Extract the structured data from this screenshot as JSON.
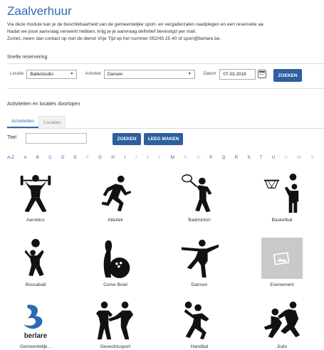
{
  "page": {
    "title": "Zaalverhuur",
    "intro_lines": [
      "Via deze module kan je de beschikbaarheid van de gemeentelijke sport- en vergaderzalen raadplegen en een reservatie aa",
      "Nadat we jouw aanvraag verwerkt hebben, krijg je je aanvraag definitief bevestigd per mail.",
      "Zoniet, neem dan contact op met de dienst Vrije Tijd op het nummer 052/43 25 40 of sport@berlare.be."
    ]
  },
  "quick_reservation": {
    "heading": "Snelle reservering",
    "location_label": "Locatie",
    "location_value": "Balletstudio",
    "activity_label": "Activiteit",
    "activity_value": "Dansen",
    "date_label": "Datum",
    "date_value": "07-03-2018",
    "search_button": "ZOEKEN"
  },
  "browse": {
    "heading": "Activiteiten en locaties doorlopen",
    "tabs": [
      "Activiteiten",
      "Locaties"
    ],
    "title_label": "Titel",
    "title_value": "",
    "search_button": "ZOEKEN",
    "clear_button": "LEEG MAKEN",
    "alphabet": [
      "A-Z",
      "A",
      "B",
      "C",
      "D",
      "E",
      "F",
      "G",
      "H",
      "I",
      "J",
      "K",
      "L",
      "M",
      "N",
      "O",
      "P",
      "Q",
      "R",
      "S",
      "T",
      "U",
      "V",
      "W",
      "X",
      "Y"
    ],
    "alphabet_inactive": [
      "F",
      "J",
      "K",
      "L",
      "N",
      "O",
      "V",
      "W",
      "X",
      "Y"
    ],
    "items": [
      {
        "label": "Aerobics",
        "icon": "aerobics-icon"
      },
      {
        "label": "Atletiek",
        "icon": "running-icon"
      },
      {
        "label": "Badminton",
        "icon": "badminton-icon"
      },
      {
        "label": "Basketbal",
        "icon": "basketball-icon"
      },
      {
        "label": "Bossaball",
        "icon": "bossaball-icon"
      },
      {
        "label": "Curve Bowl",
        "icon": "bowling-icon"
      },
      {
        "label": "Dansen",
        "icon": "dance-icon"
      },
      {
        "label": "Evenement",
        "icon": "image-placeholder-icon"
      },
      {
        "label": "Gemeentelijk...",
        "icon": "berlare-logo",
        "logo_text": "berlare"
      },
      {
        "label": "Gevechtssport",
        "icon": "combat-sport-icon"
      },
      {
        "label": "Handbal",
        "icon": "handball-icon"
      },
      {
        "label": "Judo",
        "icon": "judo-icon"
      }
    ]
  },
  "colors": {
    "accent": "#2b6bb3",
    "button": "#2e5f9e",
    "icon": "#111111",
    "placeholder": "#c9c9c9"
  }
}
